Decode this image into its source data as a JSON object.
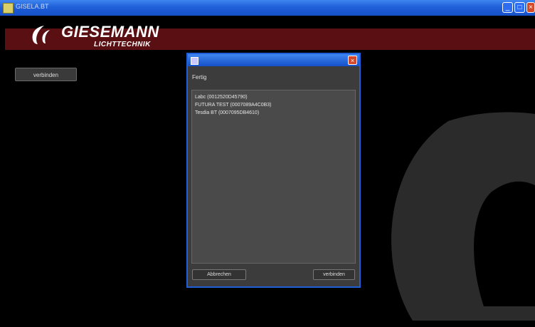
{
  "window": {
    "title": "GISELA.BT"
  },
  "brand": {
    "name": "GIESEMANN",
    "sub": "LICHTTECHNIK"
  },
  "sidebar": {
    "connect_label": "verbinden"
  },
  "dialog": {
    "status": "Fertig",
    "devices": [
      "Labc (0012520D45790)",
      "FUTURA TEST (0007089A4C0B3)",
      "Tesdia BT (0007095DB4610)"
    ],
    "cancel_label": "Abbrechen",
    "connect_label": "verbinden"
  },
  "colors": {
    "header": "#5a0f13",
    "titlebar": "#1f5fd8",
    "background": "#000000"
  }
}
